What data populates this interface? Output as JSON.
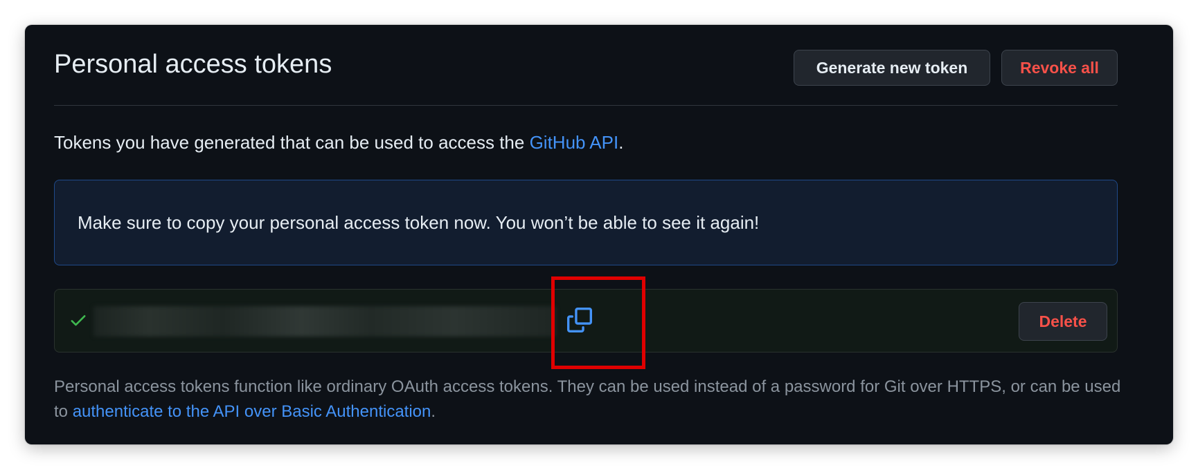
{
  "header": {
    "title": "Personal access tokens",
    "generate_label": "Generate new token",
    "revoke_label": "Revoke all"
  },
  "description": {
    "prefix": "Tokens you have generated that can be used to access the ",
    "link_text": "GitHub API",
    "suffix": "."
  },
  "flash": {
    "message": "Make sure to copy your personal access token now. You won’t be able to see it again!"
  },
  "token": {
    "value": "",
    "status": "success",
    "delete_label": "Delete",
    "check_color": "#3fb950",
    "copy_icon_color": "#4493f8"
  },
  "footnote": {
    "prefix": "Personal access tokens function like ordinary OAuth access tokens. They can be used instead of a password for Git over HTTPS, or can be used to ",
    "link_text": "authenticate to the API over Basic Authentication",
    "suffix": "."
  },
  "colors": {
    "background": "#0d1117",
    "text": "#e6edf3",
    "link": "#4493f8",
    "danger": "#f85149",
    "muted": "#8b949e",
    "highlight": "#e00000"
  }
}
